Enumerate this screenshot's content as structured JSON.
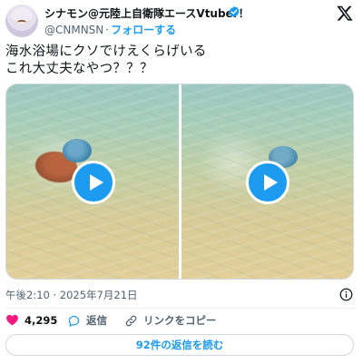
{
  "author": {
    "display_name": "シナモン@元陸上自衛隊エースVtuber！",
    "handle": "@CNMNSN",
    "separator": "·",
    "follow_label": "フォローする"
  },
  "tweet": {
    "line1": "海水浴場にクソでけえくらげいる",
    "line2": "これ大丈夫なやつ？？？",
    "timestamp": "午後2:10 · 2025年7月21日"
  },
  "actions": {
    "likes": "4,295",
    "reply_label": "返信",
    "copy_link_label": "リンクをコピー"
  },
  "read_replies_label": "92件の返信を読む",
  "colors": {
    "accent": "#1d9bf0",
    "like": "#f91880",
    "text": "#0f1419",
    "secondary": "#536471"
  },
  "icons": [
    "verified-badge-icon",
    "x-logo-icon",
    "play-icon",
    "info-icon",
    "heart-icon",
    "reply-bubble-icon",
    "link-icon"
  ]
}
